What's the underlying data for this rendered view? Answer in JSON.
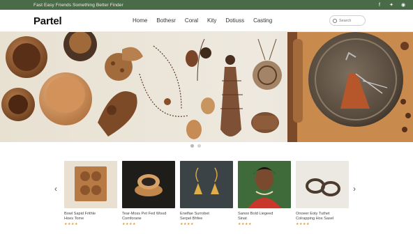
{
  "topbar": {
    "text": "Fast Easy Friends Something Better Finder",
    "social_icons": [
      "facebook-icon",
      "twitter-icon",
      "pinterest-icon"
    ]
  },
  "header": {
    "logo": "Partel",
    "nav": [
      "Home",
      "Bothesr",
      "Coral",
      "Kity",
      "Dotiuss",
      "Casting"
    ],
    "search_placeholder": "Search"
  },
  "hero": {
    "slides": 2,
    "active_slide": 1
  },
  "products": [
    {
      "title": "Bowl Sapid Frithle",
      "subtitle": "Hoes  Tome",
      "rating": "★★★★"
    },
    {
      "title": "Tear-Moss Pet Fed Wood",
      "subtitle": "Comforane",
      "rating": "★★★★"
    },
    {
      "title": "Enelfae Surrobet",
      "subtitle": "Serpel Bhfee",
      "rating": "★★★★"
    },
    {
      "title": "Sanoo Bold Liegeed",
      "subtitle": "Sinat",
      "rating": "★★★★"
    },
    {
      "title": "Onoeer Eoty Tuthet",
      "subtitle": "Colrapping Hos Sasel",
      "rating": "★★★★"
    }
  ],
  "colors": {
    "topbar": "#4a6b47",
    "accent": "#d4a13b"
  }
}
